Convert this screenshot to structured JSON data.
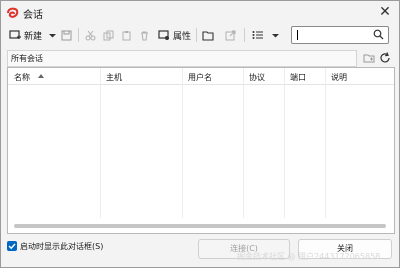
{
  "window": {
    "title": "会话"
  },
  "toolbar": {
    "new_label": "新建",
    "properties_label": "属性",
    "search_value": ""
  },
  "path": {
    "label": "所有会话"
  },
  "table": {
    "columns": [
      "名称",
      "主机",
      "用户名",
      "协议",
      "端口",
      "说明"
    ],
    "rows": []
  },
  "footer": {
    "startup_checkbox_label": "启动时显示此对话框(S)",
    "startup_checked": true,
    "connect_label": "连接(C)",
    "close_label": "关闭",
    "watermark": "掘金技术社区 @ 用户2443172065858"
  },
  "colors": {
    "accent": "#0067c0",
    "app_icon": "#e0302b"
  }
}
